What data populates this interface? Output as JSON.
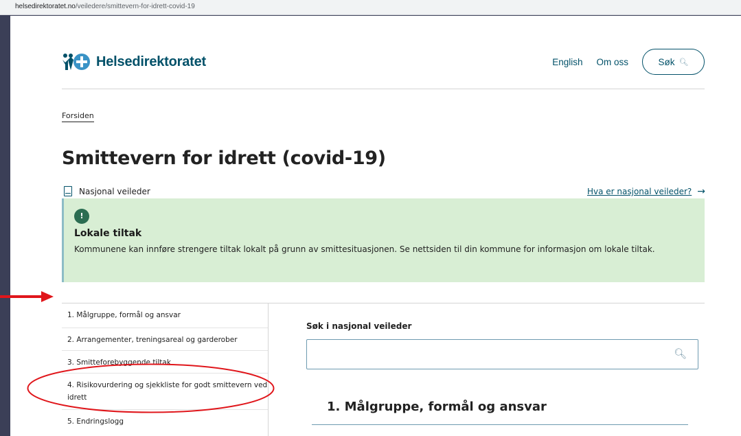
{
  "browser": {
    "url_domain": "helsedirektoratet.no",
    "url_path": "/veiledere/smittevern-for-idrett-covid-19"
  },
  "header": {
    "logo_text": "Helsedirektoratet",
    "nav_english": "English",
    "nav_about": "Om oss",
    "search_label": "Søk"
  },
  "breadcrumb": "Forsiden",
  "page_title": "Smittevern for idrett (covid-19)",
  "guide_type": "Nasjonal veileder",
  "guide_link": "Hva er nasjonal veileder?",
  "notice": {
    "badge": "!",
    "title": "Lokale tiltak",
    "text": "Kommunene kan innføre strengere tiltak lokalt på grunn av smittesituasjonen. Se nettsiden til din kommune for informasjon om lokale tiltak."
  },
  "sidebar": {
    "items": [
      "1. Målgruppe, formål og ansvar",
      "2. Arrangementer, treningsareal og garderober",
      "3. Smitteforebyggende tiltak",
      "4. Risikovurdering og sjekkliste for godt smittevern ved idrett",
      "5. Endringslogg"
    ]
  },
  "main": {
    "search_label": "Søk i nasjonal veileder",
    "search_placeholder": "",
    "section_title": "1. Målgruppe, formål og ansvar"
  },
  "colors": {
    "brand": "#025169",
    "notice_bg": "#d8eed4",
    "badge": "#2b6d52",
    "annotation": "#e0161b",
    "backdrop": "#3b3f57"
  },
  "icons": [
    "logo-icon",
    "search-icon",
    "book-icon",
    "arrow-right-icon",
    "alert-icon"
  ]
}
